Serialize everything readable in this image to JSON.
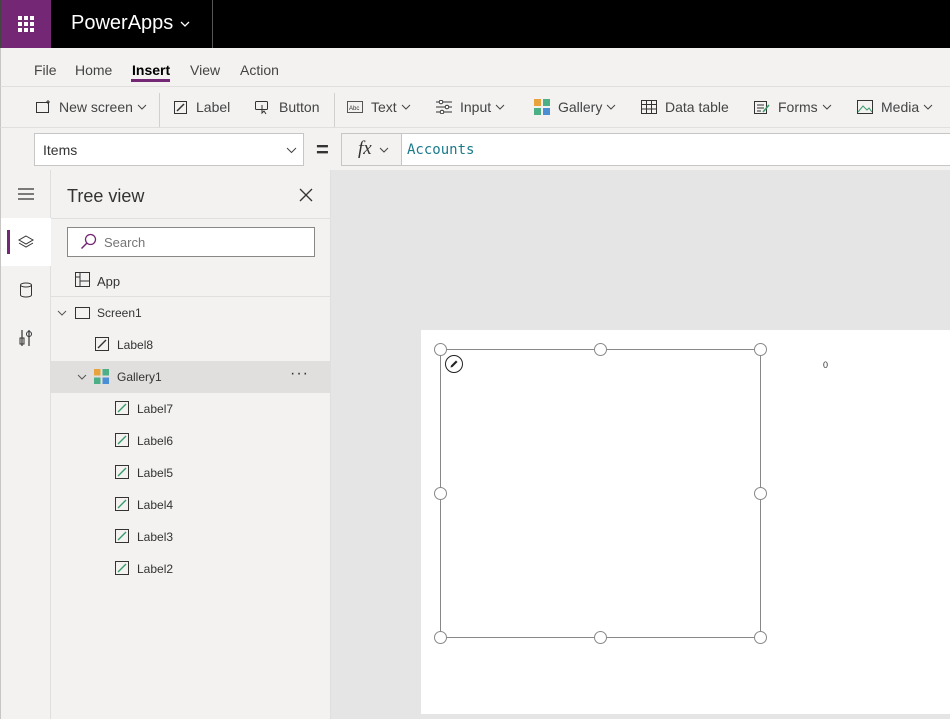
{
  "app": {
    "name": "PowerApps"
  },
  "menu": {
    "items": [
      "File",
      "Home",
      "Insert",
      "View",
      "Action"
    ],
    "active": "Insert"
  },
  "toolbar": {
    "new_screen": "New screen",
    "label": "Label",
    "button": "Button",
    "text": "Text",
    "input": "Input",
    "gallery": "Gallery",
    "data_table": "Data table",
    "forms": "Forms",
    "media": "Media"
  },
  "formula": {
    "property": "Items",
    "equals": "=",
    "fx": "fx",
    "value": "Accounts"
  },
  "tree": {
    "title": "Tree view",
    "search_placeholder": "Search",
    "app_label": "App",
    "screen": "Screen1",
    "label8": "Label8",
    "gallery": "Gallery1",
    "more": "···",
    "children": [
      "Label7",
      "Label6",
      "Label5",
      "Label4",
      "Label3",
      "Label2"
    ]
  },
  "canvas": {
    "counter": "0"
  },
  "colors": {
    "accent": "#742774",
    "formula_text": "#1b7a8c"
  }
}
